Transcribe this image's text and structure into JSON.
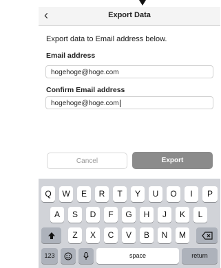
{
  "header": {
    "title": "Export Data",
    "back_icon": "chevron-left-icon"
  },
  "form": {
    "intro": "Export data to Email address below.",
    "email_label": "Email address",
    "email_value": "hogehoge@hoge.com",
    "confirm_label": "Confirm Email address",
    "confirm_value": "hogehoge@hoge.com"
  },
  "buttons": {
    "cancel": "Cancel",
    "export": "Export"
  },
  "keyboard": {
    "row1": [
      "Q",
      "W",
      "E",
      "R",
      "T",
      "Y",
      "U",
      "O",
      "I",
      "P"
    ],
    "row2": [
      "A",
      "S",
      "D",
      "F",
      "G",
      "H",
      "J",
      "K",
      "L"
    ],
    "row3": [
      "Z",
      "X",
      "C",
      "V",
      "B",
      "N",
      "M"
    ],
    "numbers_key": "123",
    "space_key": "space",
    "return_key": "return",
    "shift_icon": "shift-icon",
    "delete_icon": "delete-icon",
    "emoji_icon": "emoji-icon",
    "mic_icon": "microphone-icon"
  },
  "colors": {
    "export_button": "#8b8b8b",
    "keyboard_bg": "#d1d3d8"
  }
}
